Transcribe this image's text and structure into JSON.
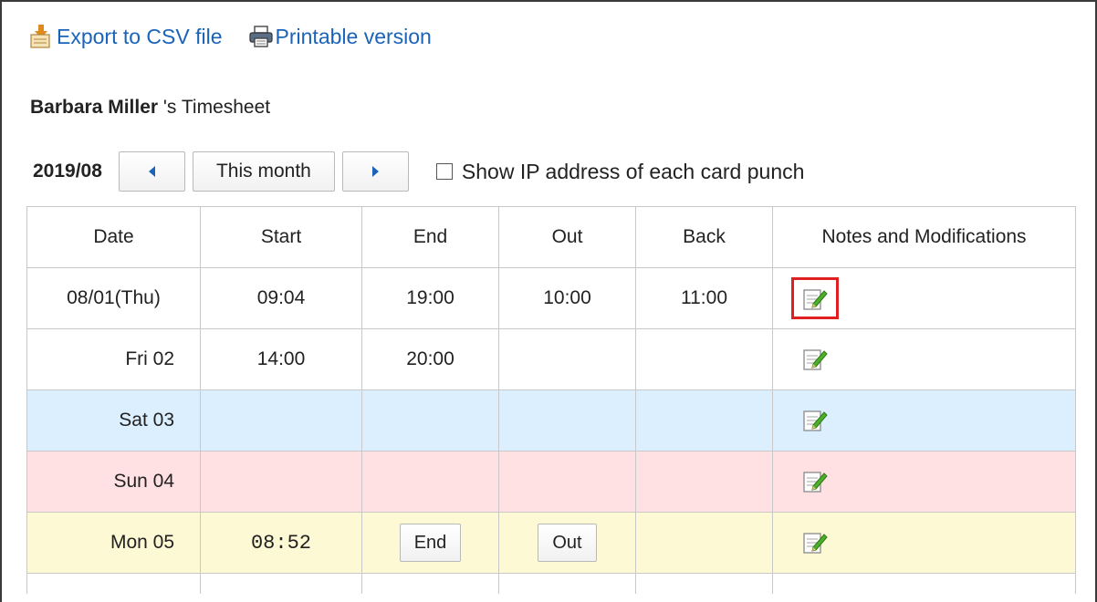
{
  "toolbar": {
    "export_label": "Export to CSV file",
    "export_icon": "csv-export-icon",
    "print_label": "Printable version",
    "print_icon": "printer-icon"
  },
  "timesheet": {
    "user_name": "Barbara Miller",
    "title_suffix": "'s Timesheet"
  },
  "nav": {
    "month": "2019/08",
    "prev_icon": "triangle-left-icon",
    "this_month_label": "This month",
    "next_icon": "triangle-right-icon",
    "show_ip_label": "Show IP address of each card punch",
    "show_ip_checked": false
  },
  "table": {
    "headers": {
      "date": "Date",
      "start": "Start",
      "end": "End",
      "out": "Out",
      "back": "Back",
      "notes": "Notes and Modifications"
    },
    "rows": [
      {
        "date": "08/01(Thu)",
        "start": "09:04",
        "end": "19:00",
        "out": "10:00",
        "back": "11:00",
        "edit_icon": "edit-note-icon",
        "highlighted": true
      },
      {
        "date": "Fri 02",
        "start": "14:00",
        "end": "20:00",
        "out": "",
        "back": "",
        "edit_icon": "edit-note-icon"
      },
      {
        "date": "Sat 03",
        "start": "",
        "end": "",
        "out": "",
        "back": "",
        "edit_icon": "edit-note-icon"
      },
      {
        "date": "Sun 04",
        "start": "",
        "end": "",
        "out": "",
        "back": "",
        "edit_icon": "edit-note-icon"
      },
      {
        "date": "Mon 05",
        "start": "08:52",
        "end_button": "End",
        "out_button": "Out",
        "back": "",
        "edit_icon": "edit-note-icon"
      }
    ]
  },
  "colors": {
    "link": "#1a63b8",
    "saturday_row": "#dcefff",
    "sunday_row": "#ffe0e3",
    "today_row": "#fcf9d4",
    "highlight_box": "#e02020"
  }
}
